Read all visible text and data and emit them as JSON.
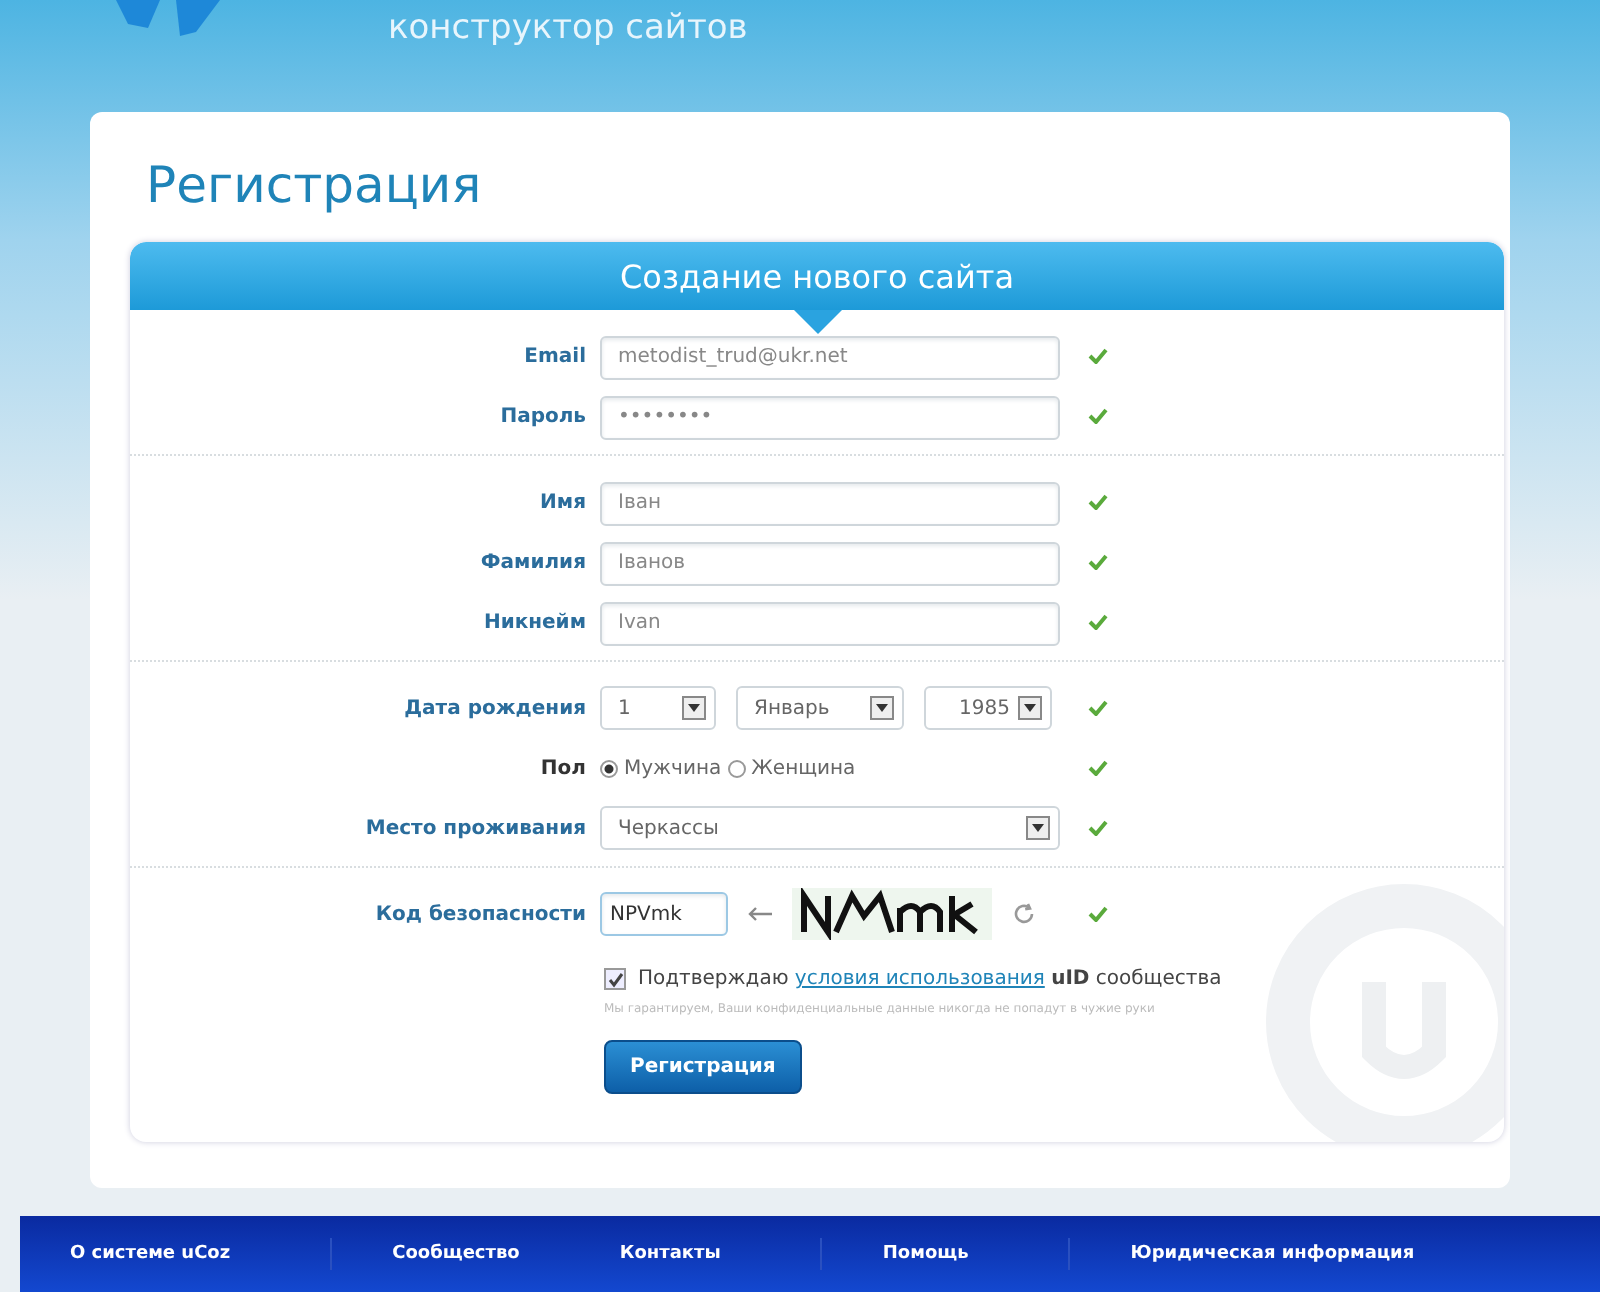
{
  "header": {
    "tagline": "конструктор сайтов"
  },
  "page_title": "Регистрация",
  "form": {
    "title": "Создание нового сайта",
    "sections": [
      {
        "rows": [
          {
            "kind": "text",
            "label": "Email",
            "value": "metodist_trud@ukr.net",
            "valid": true
          },
          {
            "kind": "text",
            "label": "Пароль",
            "value": "••••••••",
            "valid": true
          }
        ]
      },
      {
        "rows": [
          {
            "kind": "text",
            "label": "Имя",
            "value": "Іван",
            "valid": true
          },
          {
            "kind": "text",
            "label": "Фамилия",
            "value": "Іванов",
            "valid": true
          },
          {
            "kind": "text",
            "label": "Никнейм",
            "value": "Ivan",
            "valid": true
          }
        ]
      },
      {
        "rows": [
          {
            "kind": "date",
            "label": "Дата рождения",
            "selects": [
              "1",
              "Январь",
              "1985"
            ],
            "valid": true
          },
          {
            "kind": "radio",
            "label": "Пол",
            "options": [
              {
                "label": "Мужчина",
                "selected": true
              },
              {
                "label": "Женщина",
                "selected": false
              }
            ],
            "valid": true
          },
          {
            "kind": "select",
            "label": "Место проживания",
            "value": "Черкассы",
            "valid": true
          }
        ]
      },
      {
        "rows": [
          {
            "kind": "captcha",
            "label": "Код безопасности",
            "value": "NPVmk",
            "valid": true
          }
        ]
      }
    ],
    "agreement": {
      "checked": true,
      "before": "Подтверждаю",
      "link": "условия использования",
      "after": "**uID** сообщества"
    },
    "note": "Мы гарантируем, Ваши конфиденциальные данные никогда не попадут в чужие руки",
    "submit": "Регистрация"
  },
  "footer": [
    "О системе uCoz",
    "Сообщество",
    "Контакты",
    "Помощь",
    "Юридическая информация"
  ]
}
